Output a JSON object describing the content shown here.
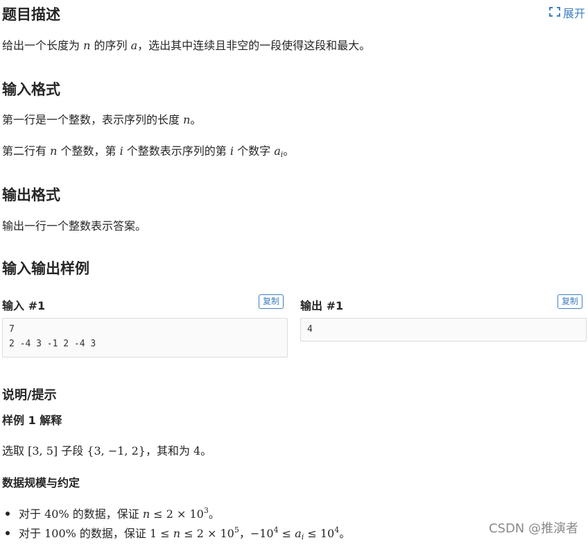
{
  "header": {
    "title": "题目描述",
    "expand_label": "展开"
  },
  "description": {
    "text_before_n": "给出一个长度为 ",
    "n": "n",
    "text_mid": " 的序列 ",
    "a": "a",
    "text_after": "，选出其中连续且非空的一段使得这段和最大。"
  },
  "input_format": {
    "heading": "输入格式",
    "line1_text": "第一行是一个整数，表示序列的长度 ",
    "line1_var": "n",
    "line1_end": "。",
    "line2_a": "第二行有 ",
    "line2_n": "n",
    "line2_b": " 个整数，第 ",
    "line2_i": "i",
    "line2_c": " 个整数表示序列的第 ",
    "line2_i2": "i",
    "line2_d": " 个数字 ",
    "line2_ai": "a",
    "line2_ai_sub": "i",
    "line2_end": "。"
  },
  "output_format": {
    "heading": "输出格式",
    "text": "输出一行一个整数表示答案。"
  },
  "samples": {
    "heading": "输入输出样例",
    "input_label": "输入 #1",
    "output_label": "输出 #1",
    "copy_label": "复制",
    "input_value": "7\n2 -4 3 -1 2 -4 3",
    "output_value": "4"
  },
  "hint": {
    "heading": "说明/提示",
    "explain_heading": "样例 1 解释",
    "explain_a": "选取 ",
    "explain_range": "[3, 5]",
    "explain_b": " 子段 ",
    "explain_set": "{3, −1, 2}",
    "explain_c": "，其和为 ",
    "explain_sum": "4",
    "explain_end": "。",
    "scale_heading": "数据规模与约定",
    "bullet1_a": "对于 ",
    "bullet1_pct": "40%",
    "bullet1_b": " 的数据，保证 ",
    "bullet1_n": "n",
    "bullet1_math": " ≤ 2 × 10",
    "bullet1_exp": "3",
    "bullet1_end": "。",
    "bullet2_a": "对于 ",
    "bullet2_pct": "100%",
    "bullet2_b": " 的数据，保证 ",
    "bullet2_m1": "1 ≤ ",
    "bullet2_n": "n",
    "bullet2_m2": " ≤ 2 × 10",
    "bullet2_exp1": "5",
    "bullet2_sep": "，",
    "bullet2_m3": "−10",
    "bullet2_exp2": "4",
    "bullet2_m4": " ≤ ",
    "bullet2_ai": "a",
    "bullet2_ai_sub": "i",
    "bullet2_m5": " ≤ 10",
    "bullet2_exp3": "4",
    "bullet2_end": "。"
  },
  "watermark": "CSDN @推演者",
  "colors": {
    "link": "#3e7fbf",
    "text": "#262626",
    "code_bg": "#fafafa"
  }
}
